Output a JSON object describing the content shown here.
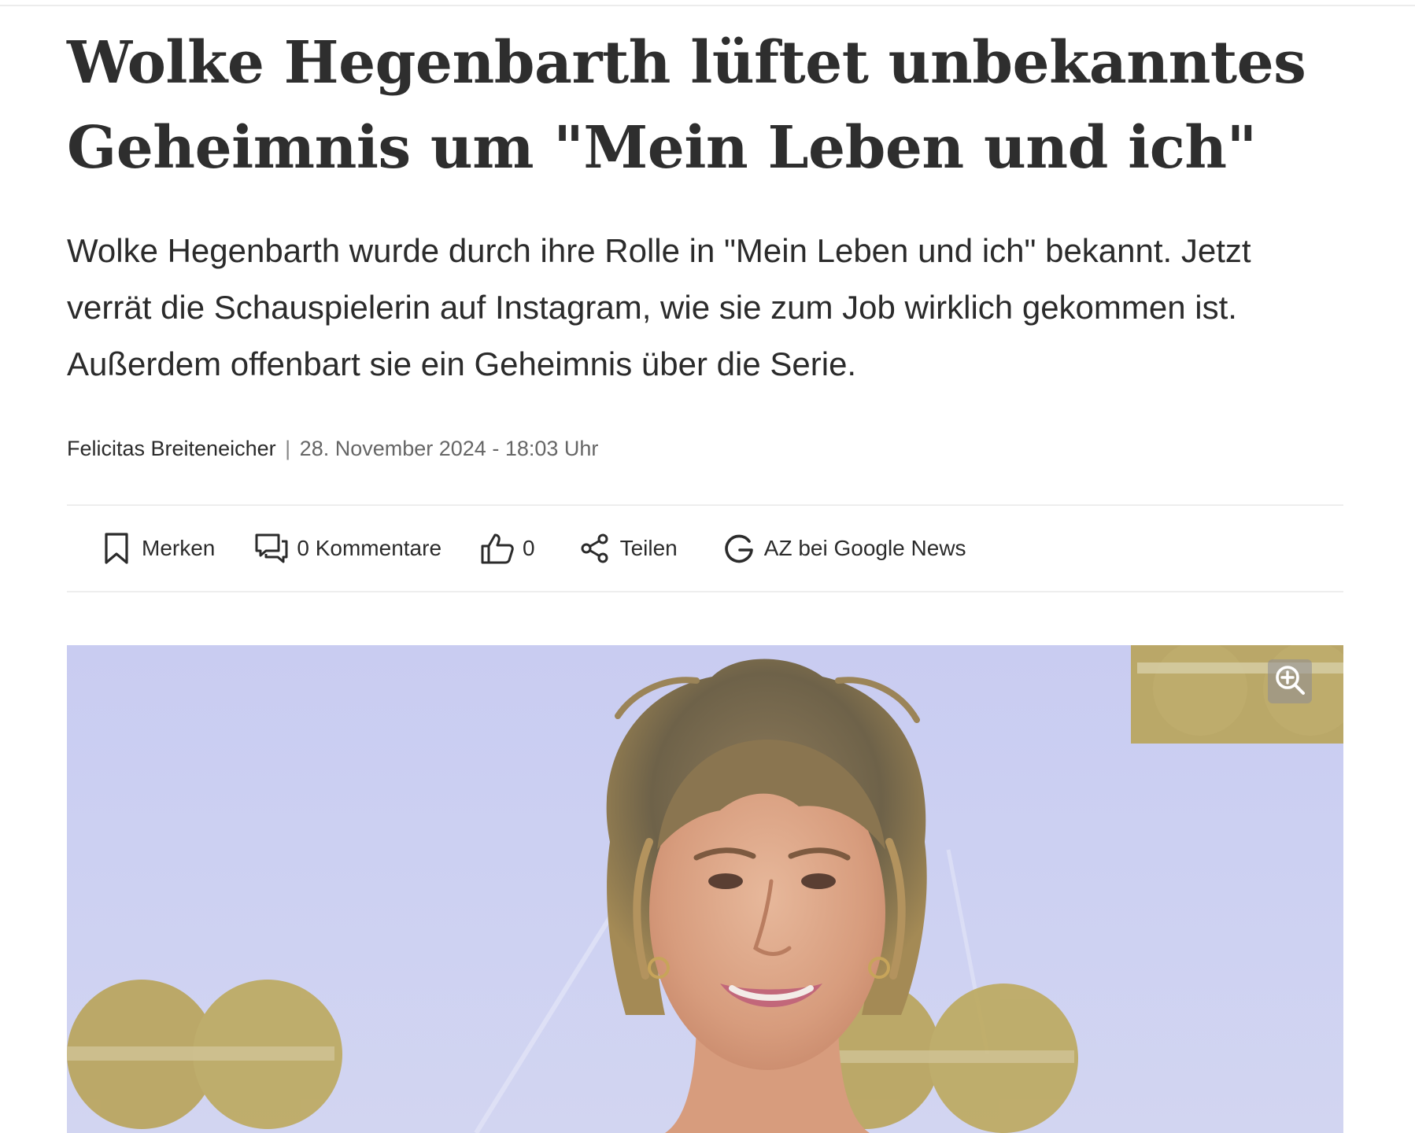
{
  "article": {
    "headline_line1": "Wolke Hegenbarth lüftet unbekanntes",
    "headline_line2": "Geheimnis um \"Mein Leben und ich\"",
    "lead": "Wolke Hegenbarth wurde durch ihre Rolle in \"Mein Leben und ich\" bekannt. Jetzt verrät die Schauspielerin auf Instagram, wie sie zum Job wirklich gekommen ist. Außerdem offenbart sie ein Geheimnis über die Serie.",
    "author": "Felicitas Breiteneicher",
    "separator": "|",
    "date": "28. November 2024 - 18:03 Uhr"
  },
  "actions": {
    "bookmark_label": "Merken",
    "comments_label": "0 Kommentare",
    "likes_count": "0",
    "share_label": "Teilen",
    "google_news_label": "AZ bei Google News"
  },
  "icons": {
    "bookmark": "bookmark-icon",
    "comments": "comments-icon",
    "like": "thumbs-up-icon",
    "share": "share-icon",
    "google": "google-g-icon",
    "zoom": "zoom-in-icon"
  },
  "colors": {
    "text": "#2b2b2b",
    "meta": "#666666",
    "divider": "#eeeeee",
    "photo_background": "#cbcff2",
    "logo_gold": "#b9a45a"
  }
}
